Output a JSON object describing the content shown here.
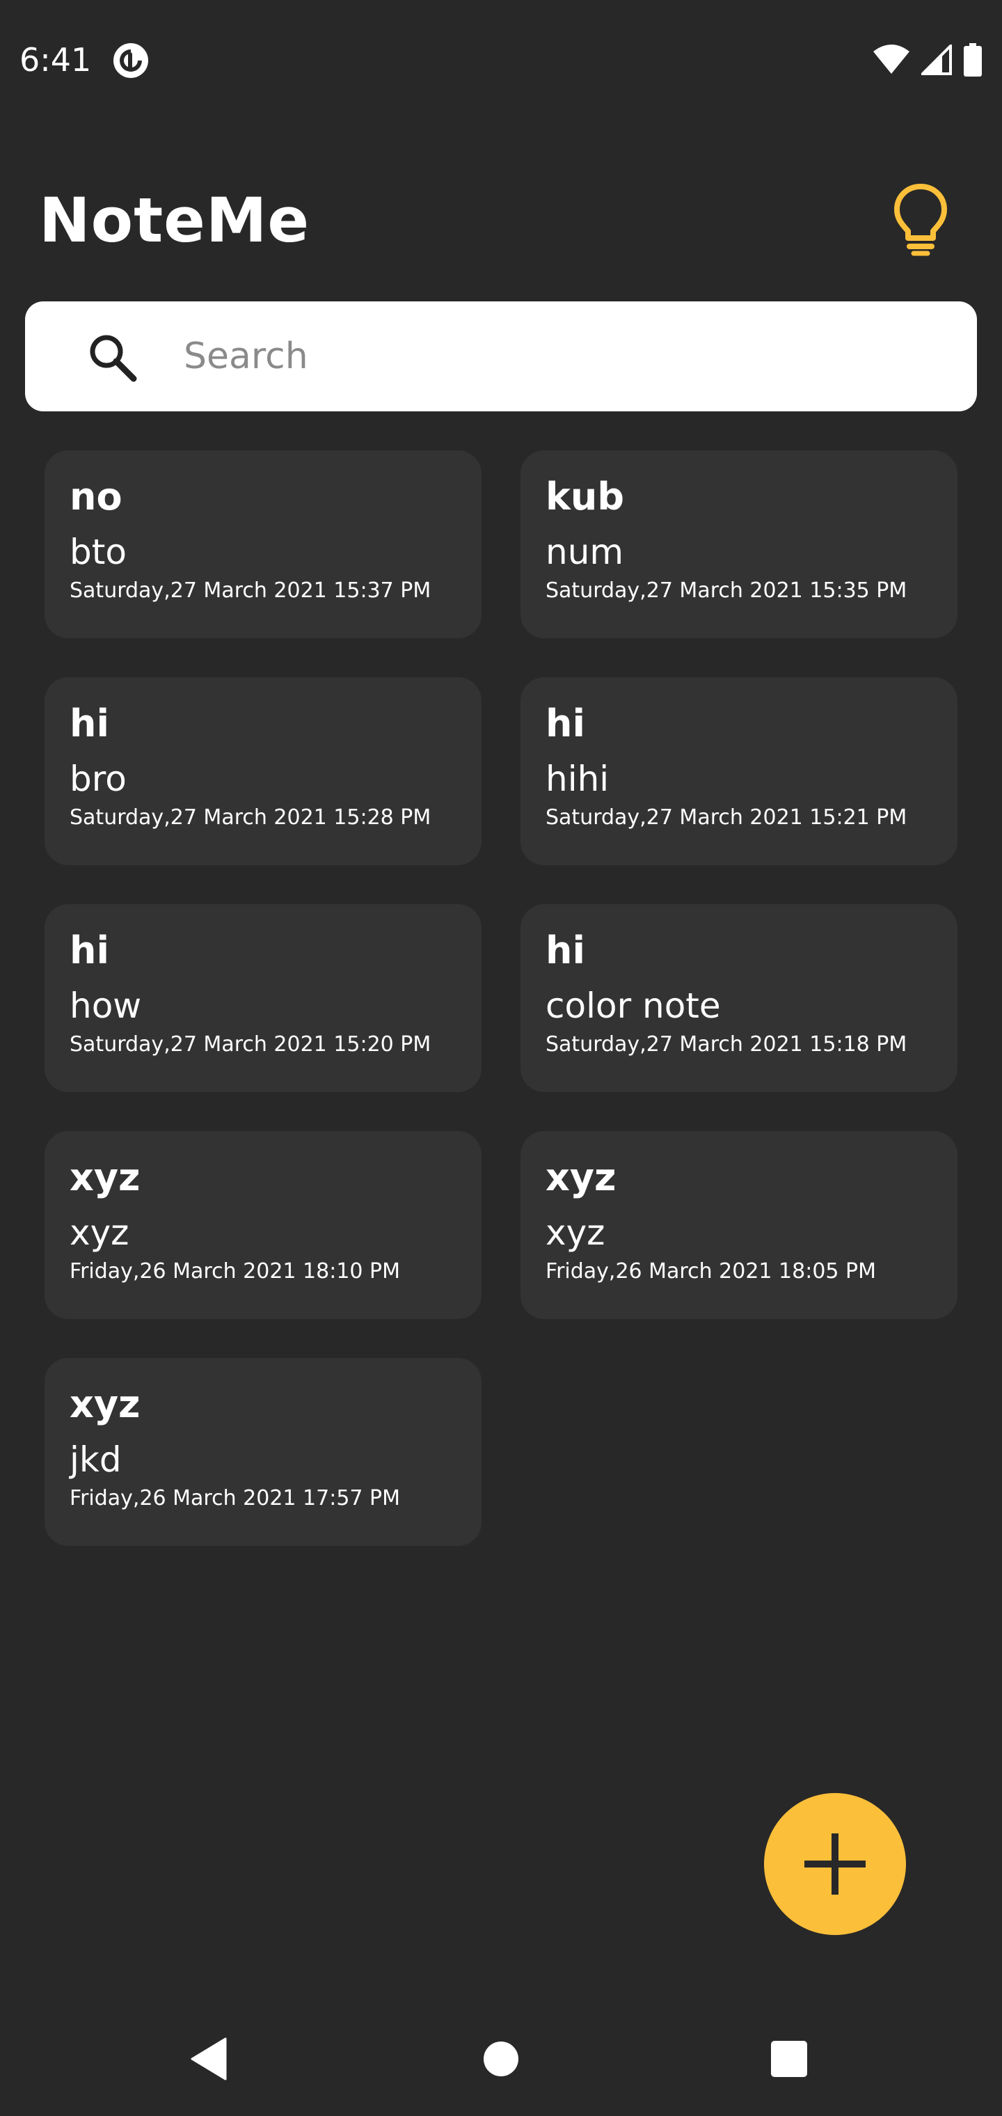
{
  "status_bar": {
    "time": "6:41",
    "app_icon": "pocket-casts-icon",
    "wifi_icon": "wifi-icon",
    "signal_icon": "cell-signal-icon",
    "battery_icon": "battery-icon"
  },
  "header": {
    "title": "NoteMe",
    "theme_toggle_icon": "lightbulb-icon",
    "accent_color": "#fbbf3a"
  },
  "search": {
    "placeholder": "Search",
    "value": ""
  },
  "notes": [
    {
      "title": "no",
      "body": "bto",
      "date": "Saturday,27 March 2021 15:37 PM"
    },
    {
      "title": "kub",
      "body": "num",
      "date": "Saturday,27 March 2021 15:35 PM"
    },
    {
      "title": "hi",
      "body": "bro",
      "date": "Saturday,27 March 2021 15:28 PM"
    },
    {
      "title": "hi",
      "body": "hihi",
      "date": "Saturday,27 March 2021 15:21 PM"
    },
    {
      "title": "hi",
      "body": "how",
      "date": "Saturday,27 March 2021 15:20 PM"
    },
    {
      "title": "hi",
      "body": "color note",
      "date": "Saturday,27 March 2021 15:18 PM"
    },
    {
      "title": "xyz",
      "body": "xyz",
      "date": "Friday,26 March 2021 18:10 PM"
    },
    {
      "title": "xyz",
      "body": "xyz",
      "date": "Friday,26 March 2021 18:05 PM"
    },
    {
      "title": "xyz",
      "body": "jkd",
      "date": "Friday,26 March 2021 17:57 PM"
    }
  ],
  "fab": {
    "icon": "plus-icon",
    "color": "#fbbf3a"
  },
  "nav_bar": {
    "back_icon": "back-triangle-icon",
    "home_icon": "home-circle-icon",
    "recents_icon": "recents-square-icon"
  },
  "colors": {
    "background": "#282828",
    "card": "#333333"
  }
}
